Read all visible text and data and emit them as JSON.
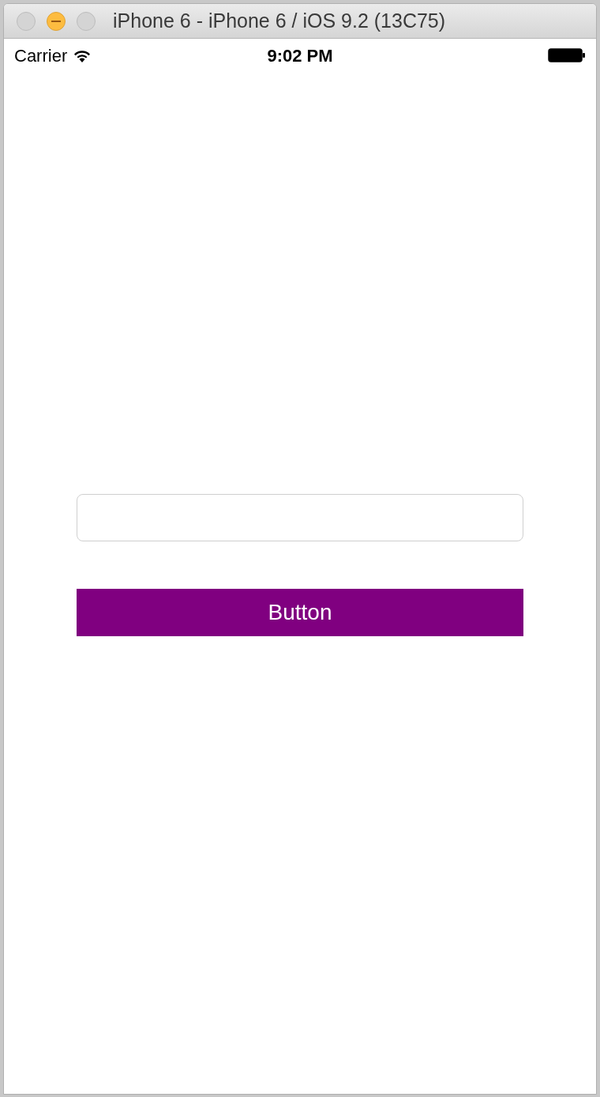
{
  "window": {
    "title": "iPhone 6 - iPhone 6 / iOS 9.2 (13C75)"
  },
  "status_bar": {
    "carrier": "Carrier",
    "time": "9:02 PM"
  },
  "button": {
    "label": "Button"
  }
}
